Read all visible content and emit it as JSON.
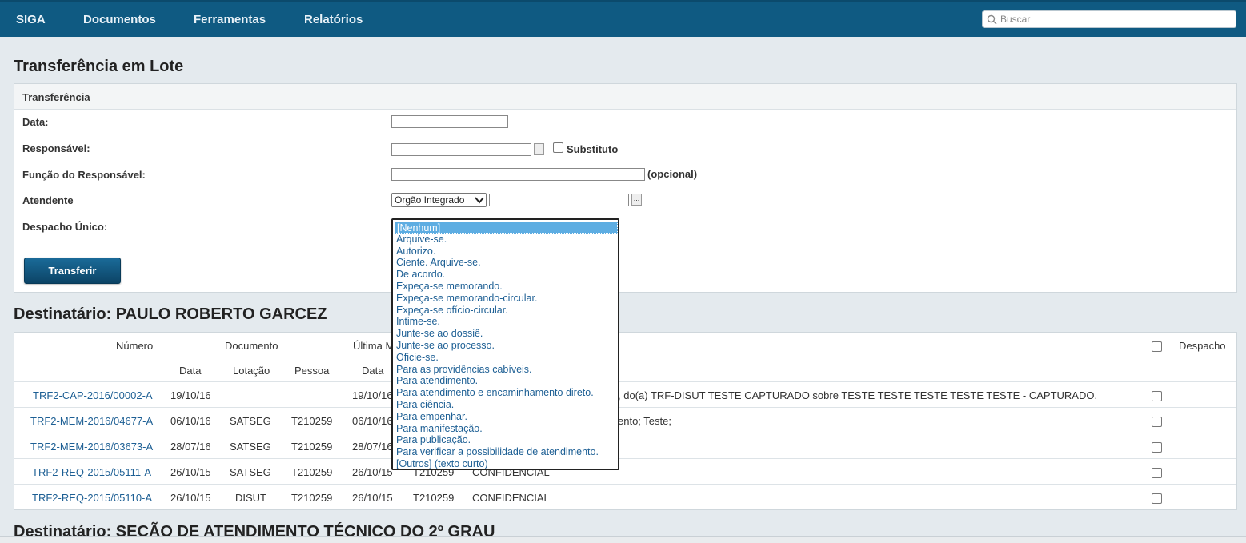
{
  "nav": {
    "items": [
      "SIGA",
      "Documentos",
      "Ferramentas",
      "Relatórios"
    ],
    "search_placeholder": "Buscar"
  },
  "page_title": "Transferência em Lote",
  "form": {
    "panel_title": "Transferência",
    "labels": {
      "data": "Data:",
      "responsavel": "Responsável:",
      "funcao": "Função do Responsável:",
      "atendente": "Atendente",
      "despacho": "Despacho Único:"
    },
    "substituto_label": "Substituto",
    "opcional_label": "(opcional)",
    "atendente_select_value": "Orgão Integrado",
    "submit_label": "Transferir",
    "dots_label": "..."
  },
  "despacho_dropdown": {
    "selected_index": 0,
    "options": [
      "[Nenhum]",
      "Arquive-se.",
      "Autorizo.",
      "Ciente. Arquive-se.",
      "De acordo.",
      "Expeça-se memorando.",
      "Expeça-se memorando-circular.",
      "Expeça-se ofício-circular.",
      "Intime-se.",
      "Junte-se ao dossiê.",
      "Junte-se ao processo.",
      "Oficie-se.",
      "Para as providências cabíveis.",
      "Para atendimento.",
      "Para atendimento e encaminhamento direto.",
      "Para ciência.",
      "Para empenhar.",
      "Para manifestação.",
      "Para publicação.",
      "Para verificar a possibilidade de atendimento.",
      "[Outros] (texto curto)"
    ]
  },
  "section1": {
    "title": "Destinatário: PAULO ROBERTO GARCEZ",
    "headers": {
      "numero": "Número",
      "documento": "Documento",
      "ultima": "Última M",
      "despacho": "Despacho",
      "data": "Data",
      "lotacao": "Lotação",
      "pessoa": "Pessoa",
      "data2": "Data"
    },
    "rows": [
      {
        "numero": "TRF2-CAP-2016/00002-A",
        "data": "19/10/16",
        "lotacao": "",
        "pessoa": "",
        "data2": "19/10/16",
        "pessoa2": "",
        "descricao": ", do(a) TRF-DISUT TESTE CAPTURADO sobre TESTE TESTE TESTE TESTE TESTE - CAPTURADO."
      },
      {
        "numero": "TRF2-MEM-2016/04677-A",
        "data": "06/10/16",
        "lotacao": "SATSEG",
        "pessoa": "T210259",
        "data2": "06/10/16",
        "pessoa2": "",
        "descricao": "ento; Teste;"
      },
      {
        "numero": "TRF2-MEM-2016/03673-A",
        "data": "28/07/16",
        "lotacao": "SATSEG",
        "pessoa": "T210259",
        "data2": "28/07/16",
        "pessoa2": "",
        "descricao": ""
      },
      {
        "numero": "TRF2-REQ-2015/05111-A",
        "data": "26/10/15",
        "lotacao": "SATSEG",
        "pessoa": "T210259",
        "data2": "26/10/15",
        "pessoa2": "T210259",
        "descricao": "CONFIDENCIAL"
      },
      {
        "numero": "TRF2-REQ-2015/05110-A",
        "data": "26/10/15",
        "lotacao": "DISUT",
        "pessoa": "T210259",
        "data2": "26/10/15",
        "pessoa2": "T210259",
        "descricao": "CONFIDENCIAL"
      }
    ]
  },
  "section2": {
    "title": "Destinatário: SEÇÃO DE ATENDIMENTO TÉCNICO DO 2º GRAU"
  }
}
